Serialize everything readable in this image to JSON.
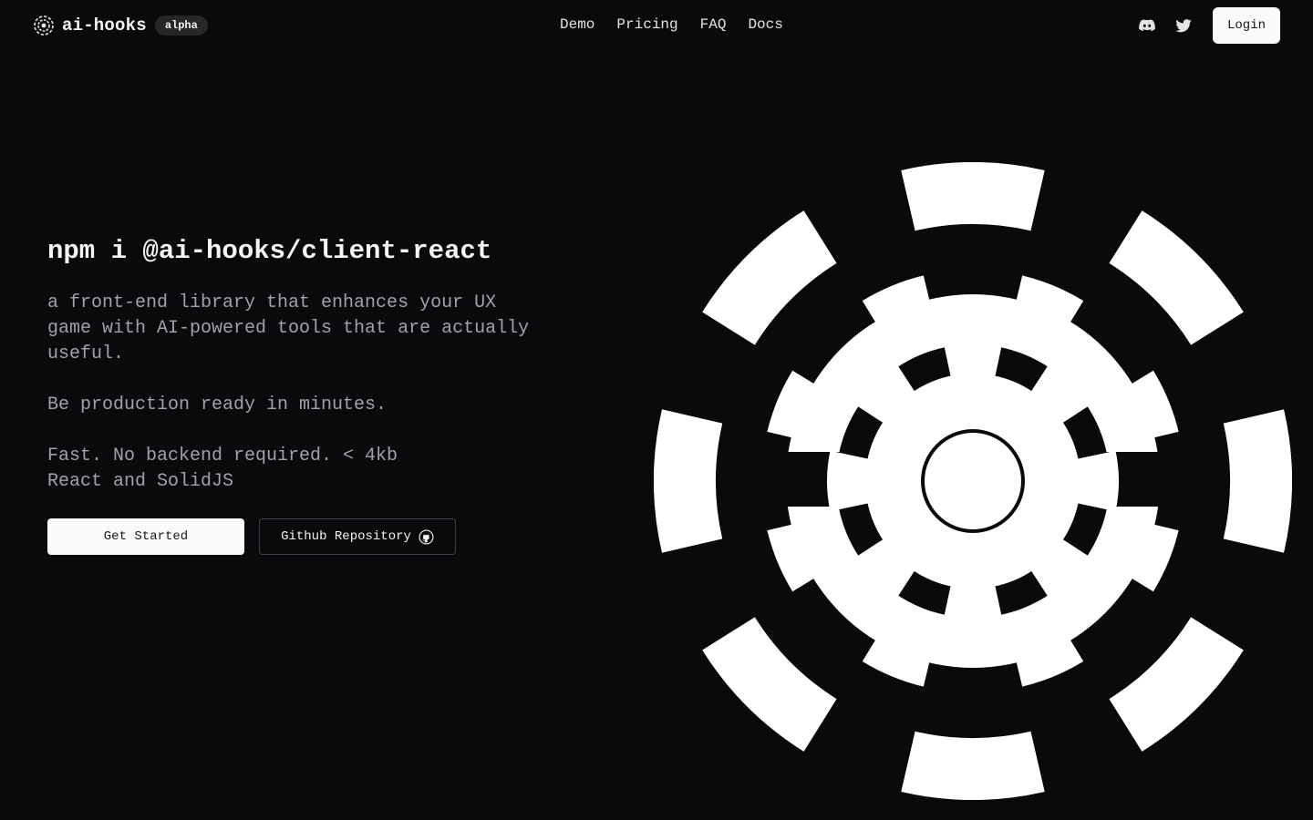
{
  "brand": {
    "name": "ai-hooks",
    "badge": "alpha",
    "logo_icon": "gear-logo-icon"
  },
  "nav": {
    "links": [
      "Demo",
      "Pricing",
      "FAQ",
      "Docs"
    ],
    "social_icons": [
      "discord-icon",
      "twitter-icon"
    ],
    "login_label": "Login"
  },
  "hero": {
    "title": "npm i @ai-hooks/client-react",
    "description": "a front-end library that enhances your UX game with AI-powered tools that are actually useful.",
    "tagline": "Be production ready in minutes.",
    "features": [
      "Fast. No backend required. < 4kb",
      "React and SolidJS"
    ],
    "primary_button": "Get Started",
    "secondary_button": "Github Repository",
    "secondary_button_icon": "github-icon"
  },
  "illustration": {
    "icon": "gear-illustration-icon",
    "color": "#ffffff",
    "background": "#0a0a0c"
  }
}
